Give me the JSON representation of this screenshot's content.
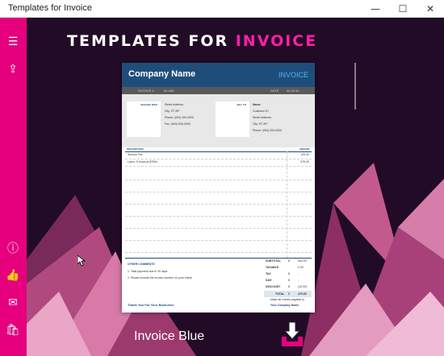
{
  "window": {
    "title": "Templates for Invoice",
    "controls": {
      "minimize": "—",
      "maximize": "☐",
      "close": "✕"
    }
  },
  "sidebar": {
    "items": [
      {
        "name": "hamburger-icon",
        "glyph": "☰"
      },
      {
        "name": "share-icon",
        "glyph": "⇪"
      },
      {
        "name": "info-icon",
        "glyph": "ⓘ"
      },
      {
        "name": "thumbs-up-icon",
        "glyph": "👍"
      },
      {
        "name": "mail-icon",
        "glyph": "✉"
      },
      {
        "name": "store-icon",
        "glyph": "🛍"
      }
    ]
  },
  "main": {
    "heading_part1": "TEMPLATES FOR",
    "heading_part2": "INVOICE",
    "card_label": "Invoice Blue"
  },
  "invoice": {
    "company_name": "Company Name",
    "invoice_word": "INVOICE",
    "bar_invoice_no": "INVOICE #",
    "bar_invoice_val": "## ###",
    "bar_date": "DATE",
    "bar_date_val": "## ## ##",
    "mailing_label": "MAILING INFO",
    "bill_label": "BILL TO",
    "from_lines": [
      "Street Address",
      "City, ST ZIP",
      "Phone: (000) 000-0000",
      "Fax: (000) 000-0000"
    ],
    "to_lines": [
      "Name",
      "Customer ID",
      "Street Address",
      "City, ST ZIP",
      "Phone: (000) 000-0000"
    ],
    "col_description": "DESCRIPTION",
    "col_amount": "AMOUNT",
    "items": [
      {
        "desc": "Service Fee",
        "amount": "125.00"
      },
      {
        "desc": "Labor: 5 hours at $75/hr",
        "amount": "375.00"
      }
    ],
    "other_comments": "OTHER COMMENTS",
    "comments": [
      "1. Total payment due in 30 days",
      "2. Please include the invoice number on your check"
    ],
    "totals": [
      {
        "label": "SUBTOTAL",
        "sym": "$",
        "value": "500.00"
      },
      {
        "label": "TAXABLE",
        "sym": "",
        "value": "0.00"
      },
      {
        "label": "TAX",
        "sym": "$",
        "value": "-"
      },
      {
        "label": "S&H",
        "sym": "$",
        "value": "-"
      },
      {
        "label": "DISCOUNT",
        "sym": "$",
        "value": "(10.00)"
      },
      {
        "label": "TOTAL",
        "sym": "$",
        "value": "470.00"
      }
    ],
    "thanks": "Thank You For Your Business!",
    "payable_line1": "Make all checks payable to",
    "payable_line2": "Your Company Name"
  },
  "colors": {
    "sidebar": "#e6007e",
    "accent_text": "#ff1ea8",
    "invoice_header": "#1f4d7a",
    "background": "#220b26"
  }
}
